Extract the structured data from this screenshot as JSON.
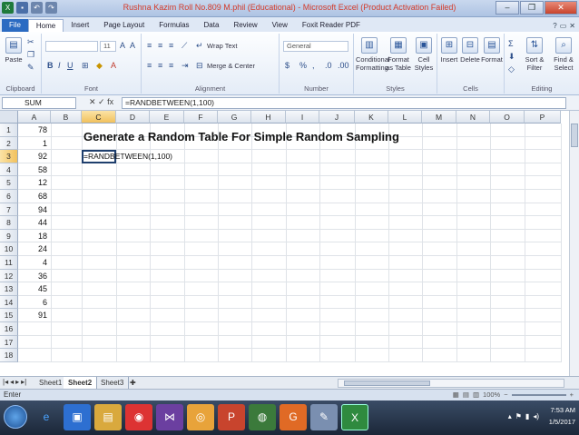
{
  "window": {
    "title": "Rushna Kazim Roll No.809 M.phil (Educational) - Microsoft Excel (Product Activation Failed)",
    "minimize": "–",
    "maximize": "❐",
    "close": "✕"
  },
  "tabs": [
    "File",
    "Home",
    "Insert",
    "Page Layout",
    "Formulas",
    "Data",
    "Review",
    "View",
    "Foxit Reader PDF"
  ],
  "ribbon": {
    "clipboard": {
      "paste": "Paste",
      "label": "Clipboard"
    },
    "font": {
      "size": "11",
      "label": "Font"
    },
    "alignment": {
      "wrap": "Wrap Text",
      "merge": "Merge & Center",
      "label": "Alignment"
    },
    "number": {
      "format": "General",
      "label": "Number"
    },
    "styles": {
      "cond": "Conditional Formatting",
      "table": "Format as Table",
      "cell": "Cell Styles",
      "label": "Styles"
    },
    "cells": {
      "insert": "Insert",
      "delete": "Delete",
      "format": "Format",
      "label": "Cells"
    },
    "editing": {
      "sort": "Sort & Filter",
      "find": "Find & Select",
      "label": "Editing"
    }
  },
  "formula_bar": {
    "name_box": "SUM",
    "fx": "✕ ✓ fx",
    "formula": "=RANDBETWEEN(1,100)"
  },
  "columns": [
    "A",
    "B",
    "C",
    "D",
    "E",
    "F",
    "G",
    "H",
    "I",
    "J",
    "K",
    "L",
    "M",
    "N",
    "O",
    "P"
  ],
  "rows": [
    "1",
    "2",
    "3",
    "4",
    "5",
    "6",
    "7",
    "8",
    "9",
    "10",
    "11",
    "12",
    "13",
    "14",
    "15",
    "16",
    "17",
    "18"
  ],
  "column_a_values": [
    "78",
    "1",
    "92",
    "58",
    "12",
    "68",
    "94",
    "44",
    "18",
    "24",
    "4",
    "36",
    "45",
    "6",
    "91",
    "",
    "",
    ""
  ],
  "heading": "Generate a Random Table For Simple Random Sampling",
  "active_cell_text": "=RANDBETWEEN(1,100)",
  "sheets": [
    "Sheet1",
    "Sheet2",
    "Sheet3"
  ],
  "status": {
    "mode": "Enter",
    "zoom": "100%"
  },
  "tray": {
    "time": "7:53 AM",
    "date": "1/5/2017"
  },
  "colors": {
    "selected_header": "#f1c15d",
    "file_tab": "#2b6bc2",
    "title_text": "#d43b2a"
  }
}
